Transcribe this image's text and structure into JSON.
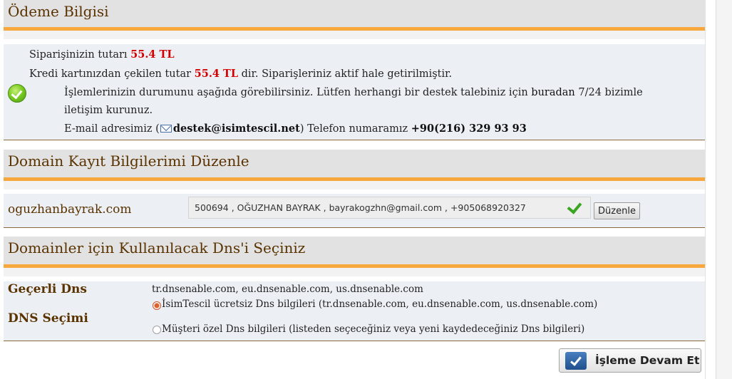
{
  "payment": {
    "title": "Ödeme Bilgisi",
    "order_total_prefix": "Siparişinizin tutarı ",
    "order_total": "55.4 TL",
    "charged_prefix": "Kredi kartınızdan çekilen tutar ",
    "charged_amount": "55.4 TL",
    "charged_suffix": " dir. Siparişleriniz aktif hale getirilmiştir.",
    "info_line1_prefix": "İşlemlerinizin durumunu aşağıda görebilirsiniz. Lütfen herhangi bir destek talebiniz için ",
    "info_link": "buradan",
    "info_line1_suffix": " 7/24 bizimle",
    "info_line2": "iletişim kurunuz.",
    "email_prefix": "E-mail adresimiz (",
    "email": "destek@isimtescil.net",
    "phone_prefix": ") Telefon numaramız ",
    "phone": "+90(216) 329 93 93"
  },
  "domain_edit": {
    "title": "Domain Kayıt Bilgilerimi Düzenle",
    "domain": "oguzhanbayrak.com",
    "contact_summary": "500694 , OĞUZHAN BAYRAK , bayrakogzhn@gmail.com , +905068920327",
    "edit_button": "Düzenle"
  },
  "dns": {
    "title": "Domainler için Kullanılacak Dns'i Seçiniz",
    "current_label": "Geçerli Dns",
    "current_value": "tr.dnsenable.com, eu.dnsenable.com, us.dnsenable.com",
    "selection_label": "DNS Seçimi",
    "options": [
      {
        "label": "İsimTescil ücretsiz Dns bilgileri (tr.dnsenable.com, eu.dnsenable.com, us.dnsenable.com)",
        "selected": true
      },
      {
        "label": "Müşteri özel Dns bilgileri (listeden seçeceğiniz veya yeni kaydedeceğiniz Dns bilgileri)",
        "selected": false
      }
    ]
  },
  "continue_button": "İşleme Devam Et",
  "colors": {
    "accent_orange": "#f6a83c",
    "heading_brown": "#5a3200",
    "price_red": "#d40000",
    "header_gray": "#e2e2e2",
    "panel_blue": "#ecf0f5"
  },
  "icons": [
    "success-check-icon",
    "mail-icon",
    "green-check-icon",
    "radio-selected-icon",
    "radio-unselected-icon",
    "confirm-check-icon"
  ]
}
